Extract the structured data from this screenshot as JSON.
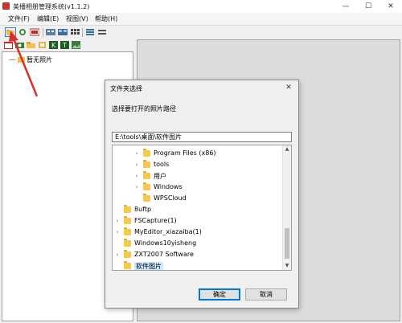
{
  "window": {
    "title": "美播相册管理系统(v1.1.2)",
    "minimize": "—",
    "maximize": "☐",
    "close": "✕"
  },
  "menu": [
    "文件(F)",
    "编辑(E)",
    "视图(V)",
    "帮助(H)"
  ],
  "tree": {
    "root_label": "暂无照片"
  },
  "dialog": {
    "title": "文件夹选择",
    "close": "✕",
    "prompt": "选择要打开的照片路径",
    "path_value": "E:\\tools\\桌面\\软件图片",
    "items": [
      {
        "label": "Program Files (x86)",
        "level": 1,
        "expand": "›"
      },
      {
        "label": "tools",
        "level": 1,
        "expand": "›"
      },
      {
        "label": "用户",
        "level": 1,
        "expand": "›"
      },
      {
        "label": "Windows",
        "level": 1,
        "expand": "›"
      },
      {
        "label": "WPSCloud",
        "level": 1,
        "expand": ""
      },
      {
        "label": "8uftp",
        "level": 0,
        "expand": ""
      },
      {
        "label": "FSCapture(1)",
        "level": 0,
        "expand": "›"
      },
      {
        "label": "MyEditor_xiazaiba(1)",
        "level": 0,
        "expand": "›"
      },
      {
        "label": "Windows10yisheng",
        "level": 0,
        "expand": ""
      },
      {
        "label": "ZXT2007 Software",
        "level": 0,
        "expand": "›"
      },
      {
        "label": "软件图片",
        "level": 0,
        "expand": "",
        "selected": true
      }
    ],
    "ok": "确定",
    "cancel": "取消"
  },
  "colors": {
    "accent": "#0078d7",
    "annotation_arrow": "#d9302c",
    "folder": "#f7c84b"
  },
  "toolbar_icons": [
    "open-folder-icon",
    "refresh-icon",
    "exif-icon",
    "grid-view-icon",
    "thumbnail-view-icon",
    "details-view-icon",
    "list-view-icon",
    "settings-icon"
  ],
  "toolbar2_icons": [
    "calendar-icon",
    "camera-icon",
    "folder-icon",
    "edit-icon",
    "k-icon",
    "t-icon",
    "image-icon"
  ]
}
